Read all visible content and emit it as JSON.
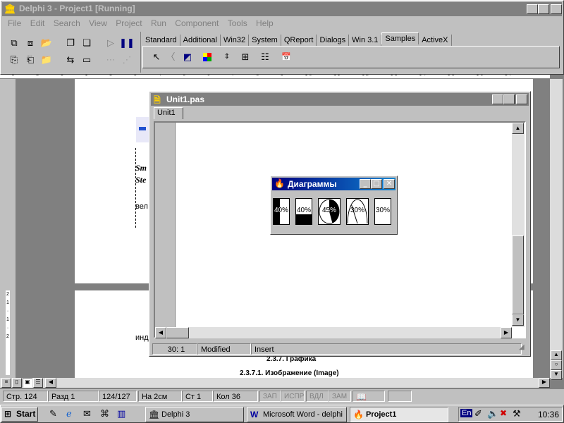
{
  "main_window": {
    "title": "Delphi 3 - Project1 [Running]"
  },
  "menu": [
    "File",
    "Edit",
    "Search",
    "View",
    "Project",
    "Run",
    "Component",
    "Tools",
    "Help"
  ],
  "palette_tabs": [
    "Standard",
    "Additional",
    "Win32",
    "System",
    "QReport",
    "Dialogs",
    "Win 3.1",
    "Samples",
    "ActiveX"
  ],
  "palette_active": "Samples",
  "icons": {
    "new": "new-form-icon",
    "open": "open-folder-icon",
    "run": "run-icon",
    "pause": "pause-icon",
    "pointer": "pointer-icon",
    "gauge": "gauge-icon",
    "colorgrid": "color-grid-icon",
    "spin": "spin-button-icon",
    "calendar": "calendar-icon"
  },
  "editor": {
    "title": "Unit1.pas",
    "tab": "Unit1",
    "status": {
      "position": "30:  1",
      "modified": "Modified",
      "mode": "Insert"
    }
  },
  "dialog": {
    "title": "Диаграммы",
    "charts": [
      {
        "label": "40%",
        "value": 40,
        "kind": "vertical"
      },
      {
        "label": "40%",
        "value": 40,
        "kind": "horizontal"
      },
      {
        "label": "45%",
        "value": 45,
        "kind": "pie"
      },
      {
        "label": "30%",
        "value": 30,
        "kind": "needle"
      },
      {
        "label": "30%",
        "value": 30,
        "kind": "text"
      }
    ]
  },
  "word_doc": {
    "frag_1": "Sm",
    "frag_2": "Ste",
    "frag_3": "вел",
    "frag_4": "инд",
    "heading_1": "2.3.7. Графика",
    "heading_2": "2.3.7.1. Изображение (Image)"
  },
  "word_status": {
    "page": "Стр.  124",
    "section": "Разд  1",
    "pages": "124/127",
    "at": "На  2см",
    "line": "Ст  1",
    "col": "Кол  36",
    "rec": "ЗАП",
    "trk": "ИСПР",
    "ext": "ВДЛ",
    "ovr": "ЗАМ"
  },
  "taskbar": {
    "start": "Start",
    "tasks": [
      "Delphi 3",
      "Microsoft Word - delphi",
      "Project1"
    ],
    "active_task": "Project1",
    "lang": "En",
    "clock": "10:36"
  },
  "colors": {
    "title_active": "#000080",
    "title_inactive": "#808080",
    "face": "#c0c0c0"
  }
}
